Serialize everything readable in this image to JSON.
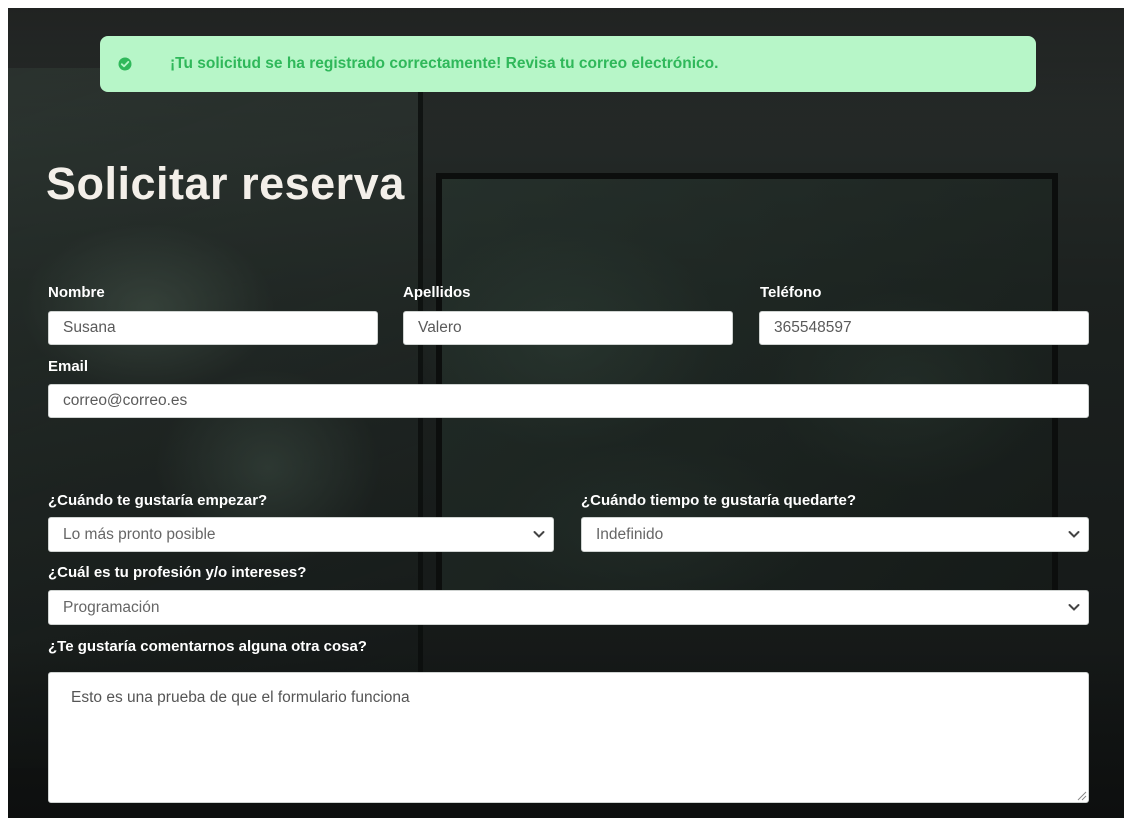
{
  "alert": {
    "icon": "check-circle-icon",
    "message": "¡Tu solicitud se ha registrado correctamente! Revisa tu correo electrónico.",
    "bg_color": "#b7f6c8",
    "text_color": "#2fb85a"
  },
  "page": {
    "title": "Solicitar reserva"
  },
  "form": {
    "nombre": {
      "label": "Nombre",
      "value": "Susana"
    },
    "apellidos": {
      "label": "Apellidos",
      "value": "Valero"
    },
    "telefono": {
      "label": "Teléfono",
      "value": "365548597"
    },
    "email": {
      "label": "Email",
      "value": "correo@correo.es"
    },
    "start": {
      "label": "¿Cuándo te gustaría empezar?",
      "selected": "Lo más pronto posible",
      "icon": "chevron-down-icon"
    },
    "duration": {
      "label": "¿Cuándo tiempo te gustaría quedarte?",
      "selected": "Indefinido",
      "icon": "chevron-down-icon"
    },
    "profession": {
      "label": "¿Cuál es tu profesión y/o intereses?",
      "selected": "Programación",
      "icon": "chevron-down-icon"
    },
    "comments": {
      "label": "¿Te gustaría comentarnos alguna otra cosa?",
      "value": "Esto es una prueba de que el formulario funciona"
    }
  }
}
